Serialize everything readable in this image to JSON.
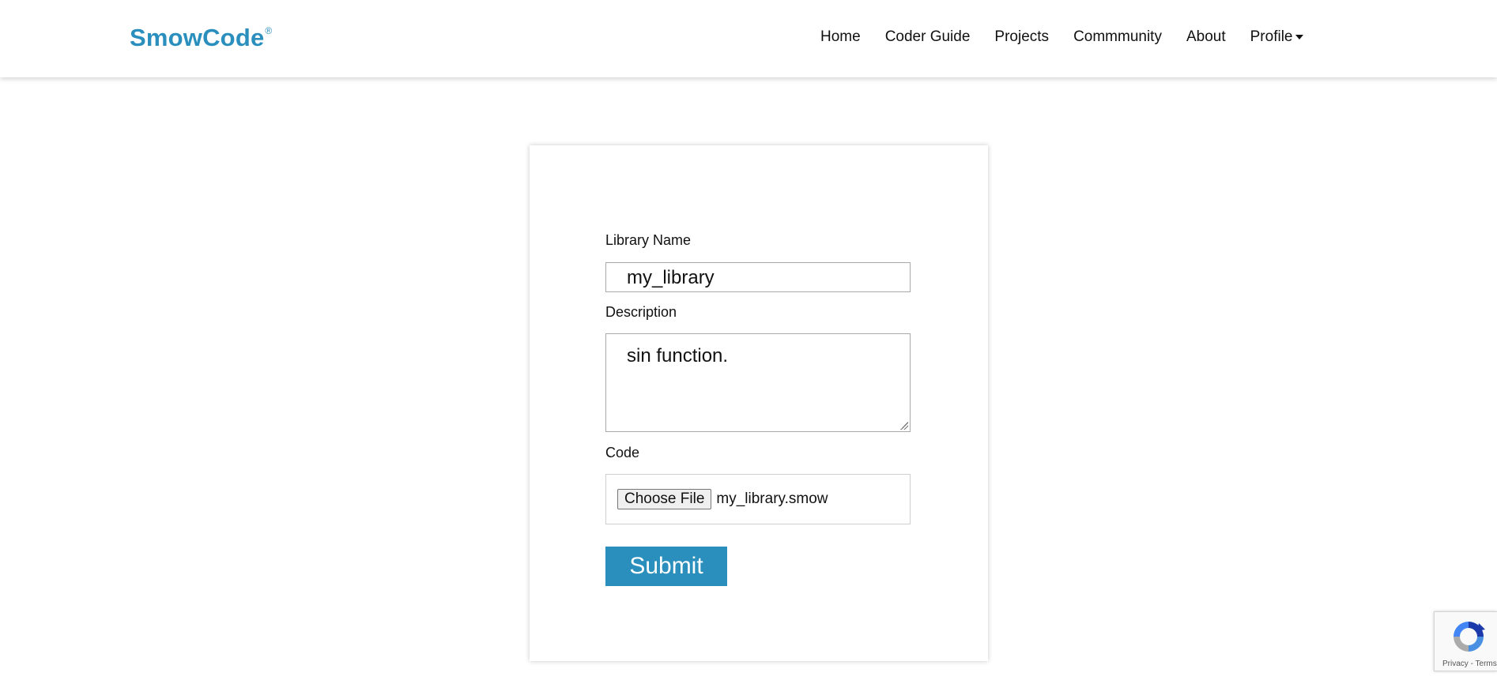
{
  "brand": {
    "name": "SmowCode",
    "mark": "®",
    "color": "#2a8fbd"
  },
  "nav": {
    "items": [
      {
        "label": "Home"
      },
      {
        "label": "Coder Guide"
      },
      {
        "label": "Projects"
      },
      {
        "label": "Commmunity"
      },
      {
        "label": "About"
      },
      {
        "label": "Profile"
      }
    ]
  },
  "form": {
    "library_name_label": "Library Name",
    "library_name_value": "my_library",
    "description_label": "Description",
    "description_value": "sin function.",
    "code_label": "Code",
    "choose_file_label": "Choose File",
    "file_name": "my_library.smow",
    "submit_label": "Submit",
    "accent": "#2a8fbd"
  },
  "recaptcha": {
    "privacy": "Privacy",
    "separator": "-",
    "terms": "Terms",
    "icon": "recaptcha-icon"
  }
}
